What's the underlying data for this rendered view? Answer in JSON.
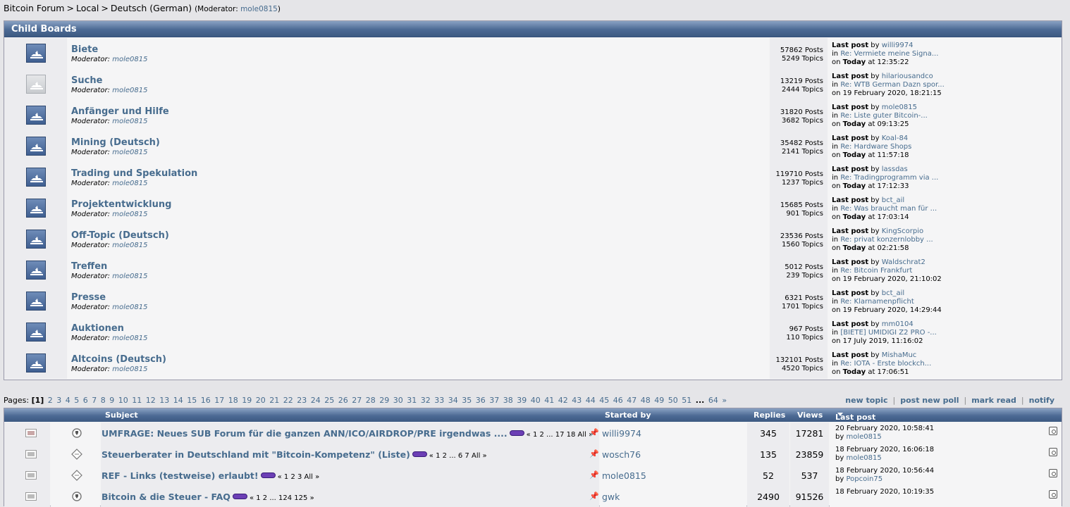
{
  "breadcrumb": {
    "items": [
      "Bitcoin Forum",
      "Local",
      "Deutsch (German)"
    ],
    "separator": ">",
    "moderator_prefix": "(Moderator:",
    "moderator": "mole0815",
    "moderator_suffix": ")"
  },
  "child_boards": {
    "title": "Child Boards",
    "moderator_label": "Moderator:",
    "last_post_label": "Last post",
    "by_label": "by",
    "in_label": "in",
    "on_label": "on",
    "boards": [
      {
        "name": "Biete",
        "moderator": "mole0815",
        "posts": "57862 Posts",
        "topics": "5249 Topics",
        "last_by": "willi9974",
        "last_in": "Re: Vermiete meine Signa...",
        "last_day": "Today",
        "last_at": "at 12:35:22"
      },
      {
        "name": "Suche",
        "moderator": "mole0815",
        "posts": "13219 Posts",
        "topics": "2444 Topics",
        "last_by": "hilariousandco",
        "last_in": "Re: WTB German Dazn spor...",
        "last_day": "",
        "last_at": "19 February 2020, 18:21:15"
      },
      {
        "name": "Anfänger und Hilfe",
        "moderator": "mole0815",
        "posts": "31820 Posts",
        "topics": "3682 Topics",
        "last_by": "mole0815",
        "last_in": "Re: Liste guter Bitcoin-...",
        "last_day": "Today",
        "last_at": "at 09:13:25"
      },
      {
        "name": "Mining (Deutsch)",
        "moderator": "mole0815",
        "posts": "35482 Posts",
        "topics": "2141 Topics",
        "last_by": "Koal-84",
        "last_in": "Re: Hardware Shops",
        "last_day": "Today",
        "last_at": "at 11:57:18"
      },
      {
        "name": "Trading und Spekulation",
        "moderator": "mole0815",
        "posts": "119710 Posts",
        "topics": "1237 Topics",
        "last_by": "lassdas",
        "last_in": "Re: Tradingprogramm via ...",
        "last_day": "Today",
        "last_at": "at 17:12:33"
      },
      {
        "name": "Projektentwicklung",
        "moderator": "mole0815",
        "posts": "15685 Posts",
        "topics": "901 Topics",
        "last_by": "bct_ail",
        "last_in": "Re: Was braucht man für ...",
        "last_day": "Today",
        "last_at": "at 17:03:14"
      },
      {
        "name": "Off-Topic (Deutsch)",
        "moderator": "mole0815",
        "posts": "23536 Posts",
        "topics": "1560 Topics",
        "last_by": "KingScorpio",
        "last_in": "Re: privat konzernlobby ...",
        "last_day": "Today",
        "last_at": "at 02:21:58"
      },
      {
        "name": "Treffen",
        "moderator": "mole0815",
        "posts": "5012 Posts",
        "topics": "239 Topics",
        "last_by": "Waldschrat2",
        "last_in": "Re: Bitcoin Frankfurt",
        "last_day": "",
        "last_at": "19 February 2020, 21:10:02"
      },
      {
        "name": "Presse",
        "moderator": "mole0815",
        "posts": "6321 Posts",
        "topics": "1701 Topics",
        "last_by": "bct_ail",
        "last_in": "Re: Klarnamenpflicht",
        "last_day": "",
        "last_at": "19 February 2020, 14:29:44"
      },
      {
        "name": "Auktionen",
        "moderator": "mole0815",
        "posts": "967 Posts",
        "topics": "110 Topics",
        "last_by": "mm0104",
        "last_in": "[BIETE] UMIDIGI Z2 PRO -...",
        "last_day": "",
        "last_at": "17 July 2019, 11:16:02"
      },
      {
        "name": "Altcoins (Deutsch)",
        "moderator": "mole0815",
        "posts": "132101 Posts",
        "topics": "4520 Topics",
        "last_by": "MishaMuc",
        "last_in": "Re: IOTA - Erste blockch...",
        "last_day": "Today",
        "last_at": "at 17:06:51"
      }
    ]
  },
  "pagination": {
    "label": "Pages:",
    "current": "[1]",
    "pages": [
      "2",
      "3",
      "4",
      "5",
      "6",
      "7",
      "8",
      "9",
      "10",
      "11",
      "12",
      "13",
      "14",
      "15",
      "16",
      "17",
      "18",
      "19",
      "20",
      "21",
      "22",
      "23",
      "24",
      "25",
      "26",
      "27",
      "28",
      "29",
      "30",
      "31",
      "32",
      "33",
      "34",
      "35",
      "36",
      "37",
      "38",
      "39",
      "40",
      "41",
      "42",
      "43",
      "44",
      "45",
      "46",
      "47",
      "48",
      "49",
      "50",
      "51"
    ],
    "ellipsis": "...",
    "last": "64",
    "next": "»"
  },
  "actions": [
    "new topic",
    "post new poll",
    "mark read",
    "notify"
  ],
  "topics_table": {
    "headers": {
      "subject": "Subject",
      "started_by": "Started by",
      "replies": "Replies",
      "views": "Views",
      "last_post": "Last post"
    },
    "by_label": "by",
    "rows": [
      {
        "subject": "UMFRAGE: Neues SUB Forum für die ganzen ANN/ICO/AIRDROP/PRE irgendwas ....",
        "pages": "« 1 2 ... 17 18  All »",
        "starter": "willi9974",
        "replies": "345",
        "views": "17281",
        "last_date": "20 February 2020, 10:58:41",
        "last_by": "mole0815"
      },
      {
        "subject": "Steuerberater in Deutschland mit \"Bitcoin-Kompetenz\" (Liste)",
        "pages": "« 1 2 ... 6 7  All »",
        "starter": "wosch76",
        "replies": "135",
        "views": "23859",
        "last_date": "18 February 2020, 16:06:18",
        "last_by": "mole0815"
      },
      {
        "subject": "REF - Links (testweise) erlaubt!",
        "pages": "« 1 2 3  All »",
        "starter": "mole0815",
        "replies": "52",
        "views": "537",
        "last_date": "18 February 2020, 10:56:44",
        "last_by": "Popcoin75"
      },
      {
        "subject": "Bitcoin & die Steuer - FAQ",
        "pages": "« 1 2 ... 124 125 »",
        "starter": "gwk",
        "replies": "2490",
        "views": "91526",
        "last_date": "18 February 2020, 10:19:35",
        "last_by": ""
      }
    ]
  }
}
